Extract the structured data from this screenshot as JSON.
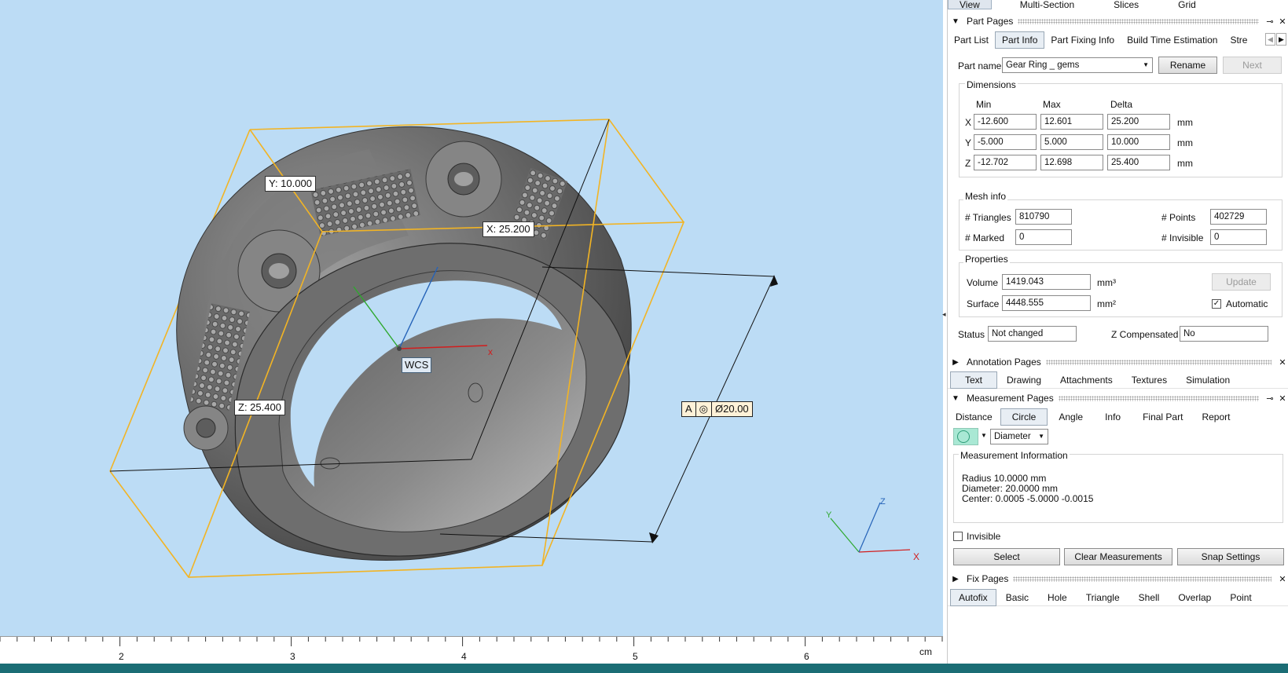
{
  "viewport": {
    "labels": {
      "y": "Y: 10.000",
      "x": "X: 25.200",
      "z": "Z: 25.400",
      "wcs": "WCS"
    },
    "dimension_tag": {
      "a": "A",
      "symbol": "◎",
      "value": "Ø20.00"
    },
    "axes": {
      "x": "X",
      "y": "Y",
      "z": "Z"
    },
    "ruler": {
      "ticks": [
        "2",
        "3",
        "4",
        "5",
        "6"
      ],
      "unit": "cm"
    }
  },
  "top_tabs": [
    "View",
    "Multi-Section",
    "Slices",
    "Grid"
  ],
  "part_pages": {
    "title": "Part Pages",
    "tabs": [
      "Part List",
      "Part Info",
      "Part Fixing Info",
      "Build Time Estimation",
      "Stre"
    ],
    "part_name_label": "Part name",
    "part_name": "Gear Ring _ gems",
    "rename": "Rename",
    "next": "Next",
    "dimensions": {
      "title": "Dimensions",
      "headers": [
        "Min",
        "Max",
        "Delta"
      ],
      "rows": [
        {
          "axis": "X",
          "min": "-12.600",
          "max": "12.601",
          "delta": "25.200",
          "unit": "mm"
        },
        {
          "axis": "Y",
          "min": "-5.000",
          "max": "5.000",
          "delta": "10.000",
          "unit": "mm"
        },
        {
          "axis": "Z",
          "min": "-12.702",
          "max": "12.698",
          "delta": "25.400",
          "unit": "mm"
        }
      ]
    },
    "mesh_info": {
      "title": "Mesh info",
      "triangles_label": "# Triangles",
      "triangles": "810790",
      "points_label": "# Points",
      "points": "402729",
      "marked_label": "# Marked",
      "marked": "0",
      "invisible_label": "# Invisible",
      "invisible": "0"
    },
    "properties": {
      "title": "Properties",
      "volume_label": "Volume",
      "volume": "1419.043",
      "volume_unit": "mm³",
      "surface_label": "Surface",
      "surface": "4448.555",
      "surface_unit": "mm²",
      "update": "Update",
      "automatic": "Automatic",
      "automatic_checked": true
    },
    "status_label": "Status",
    "status": "Not changed",
    "zcomp_label": "Z Compensated",
    "zcomp": "No"
  },
  "annotation_pages": {
    "title": "Annotation Pages",
    "tabs": [
      "Text",
      "Drawing",
      "Attachments",
      "Textures",
      "Simulation"
    ]
  },
  "measurement_pages": {
    "title": "Measurement Pages",
    "tabs": [
      "Distance",
      "Circle",
      "Angle",
      "Info",
      "Final Part",
      "Report"
    ],
    "mode": "Diameter",
    "info_title": "Measurement Information",
    "info_lines": [
      "Radius 10.0000 mm",
      "Diameter: 20.0000 mm",
      "Center: 0.0005 -5.0000 -0.0015"
    ],
    "invisible": "Invisible",
    "buttons": [
      "Select",
      "Clear Measurements",
      "Snap Settings"
    ]
  },
  "fix_pages": {
    "title": "Fix Pages",
    "tabs": [
      "Autofix",
      "Basic",
      "Hole",
      "Triangle",
      "Shell",
      "Overlap",
      "Point"
    ]
  },
  "colors": {
    "viewport_bg": "#bcdcf5",
    "bbox": "#f2b424",
    "ring": "#6e6e6e",
    "bottom_bar": "#1b6d75"
  }
}
